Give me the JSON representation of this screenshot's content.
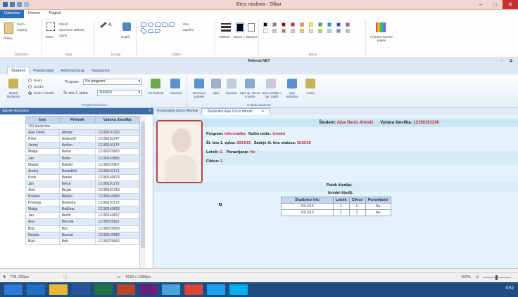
{
  "window": {
    "title": "Brez naslova - Slikar",
    "colors": {
      "title_bg": "#f3d6cf",
      "close": "#c7302d",
      "accent": "#2a70c0"
    }
  },
  "ribbon": {
    "tabs": [
      "Datoteka",
      "Domov",
      "Pogled"
    ],
    "groups": [
      "Odložišče",
      "Slika",
      "Orodja",
      "Oblike",
      "Barve"
    ],
    "labels": {
      "paste": "Prilepi",
      "cut": "Izreži",
      "copy": "Kopiraj",
      "select": "Izberi",
      "crop": "Obreži",
      "resize": "Spremeni velikost",
      "rotate": "Zavrti",
      "brushes": "Čopiči",
      "outline": "Oris",
      "fill": "Zapolni",
      "size": "Velikost",
      "color1": "Barva 1",
      "color2": "Barva 2",
      "edit_colors": "Pripravo barvne palete"
    }
  },
  "app": {
    "title": "Referat.NET",
    "tabs": [
      "Študenti",
      "Predavatelji",
      "Administracija",
      "Nastavitve"
    ],
    "filter": {
      "radio_all": "Redni",
      "radio_part": "Izredni",
      "radio_both": "Redni / Izredni",
      "program_label": "Program:",
      "program_value": "Vsi programi",
      "year_label": "Št. leto 1. vpisa:",
      "year_value": "2014/15"
    },
    "ribbon_buttons": {
      "list": "Spisek študentov",
      "all": "Vsi študenti",
      "active": "Aktivnost",
      "grades": "Ocenevni podatki",
      "print": "Izpiti",
      "notes": "Opombe",
      "exam_name": "Izpis up. imena in gesla",
      "cert_print": "Izpis potrdila o opr. izpitih",
      "enroll": "Vpis podatkov",
      "pass": "Gesla"
    },
    "ribbon_groups": {
      "view": "Pregled študentov",
      "data": "Podatki študenta"
    },
    "colors": {
      "header_bg": "#3b6ea7",
      "band": "#c9e4f3",
      "pane": "#e4f3fb",
      "highlight": "#c0262b"
    }
  },
  "left_pane": {
    "title": "Spisek študentov",
    "close": "✕",
    "columns": [
      "Ime",
      "Priimek",
      "Vpisna številka"
    ],
    "count": "153 študentov",
    "rows": [
      [
        "Ajse Deniz",
        "Altındz",
        "12190191206"
      ],
      [
        "Peter",
        "Ambrožič",
        "12190191147"
      ],
      [
        "Jernej",
        "Aničon",
        "12190191174"
      ],
      [
        "Matija",
        "Bačar",
        "12190220963"
      ],
      [
        "Jan",
        "Bašin",
        "12190140656"
      ],
      [
        "Matjaž",
        "Batistič",
        "12190220907"
      ],
      [
        "Andrej",
        "Benedičič",
        "12190191171"
      ],
      [
        "Kristi",
        "Benko",
        "12190140679"
      ],
      [
        "Jan",
        "Berce",
        "12190191175"
      ],
      [
        "Aleš",
        "Bizjak",
        "12190191218"
      ],
      [
        "Kristian",
        "Blaško",
        "12190140668"
      ],
      [
        "Predrag",
        "Bodiroža",
        "12190191173"
      ],
      [
        "Matija",
        "Boščina",
        "12190140669"
      ],
      [
        "Jan",
        "Brelih",
        "12190140657"
      ],
      [
        "Ana",
        "Breznik",
        "12190220921"
      ],
      [
        "Blaž",
        "Bric",
        "12190220959"
      ],
      [
        "Nataša",
        "Brumat",
        "12190140682"
      ],
      [
        "Blaž",
        "Buh",
        "12190220960"
      ]
    ]
  },
  "right_pane": {
    "tabs": [
      "Predavatelj Simon Abolnar",
      "Študentka Ajse Deniz Altındz"
    ],
    "tab_close": "✕",
    "student_label": "Študent:",
    "student_name": "Ajse Deniz Altındz",
    "enroll_label": "Vpisna številka:",
    "enroll_value": "12190191206",
    "program_label": "Program:",
    "program_value": "Informatika",
    "mode_label": "Način izobr.:",
    "mode_value": "Izredni",
    "first_year_label": "Št. leto 1. vpisa:",
    "first_year_value": "2014/15",
    "last_year_label": "Zadnje št. leto statusa:",
    "last_year_value": "2015/16",
    "letnik_label": "Letnik:",
    "letnik_value": "2.",
    "ponavljanje_label": "Ponavljanje:",
    "ponavljanje_value": "Ne",
    "ciklus_label": "Ciklus:",
    "ciklus_value": "2.",
    "history_title": "Potek študija:",
    "history_mode": "Izredni študij:",
    "history_columns": [
      "Študijsko leto",
      "Letnik",
      "Ciklus",
      "Ponavljanje"
    ],
    "history_rows": [
      [
        "2014/15",
        "1.",
        "1.",
        "Ne"
      ],
      [
        "2015/16",
        "2.",
        "2.",
        "Ne"
      ]
    ]
  },
  "statusbar": {
    "coords": "778, 620px",
    "canvas_size": "1920 x 1080px",
    "zoom": "100%"
  },
  "taskbar": {
    "apps": [
      "start-icon",
      "outlook-icon",
      "folder-icon",
      "word-icon",
      "excel-icon",
      "powerpoint-icon",
      "visualstudio-icon",
      "paint-icon",
      "chrome-icon",
      "ie-icon",
      "skype-icon"
    ],
    "time": "9:52"
  }
}
